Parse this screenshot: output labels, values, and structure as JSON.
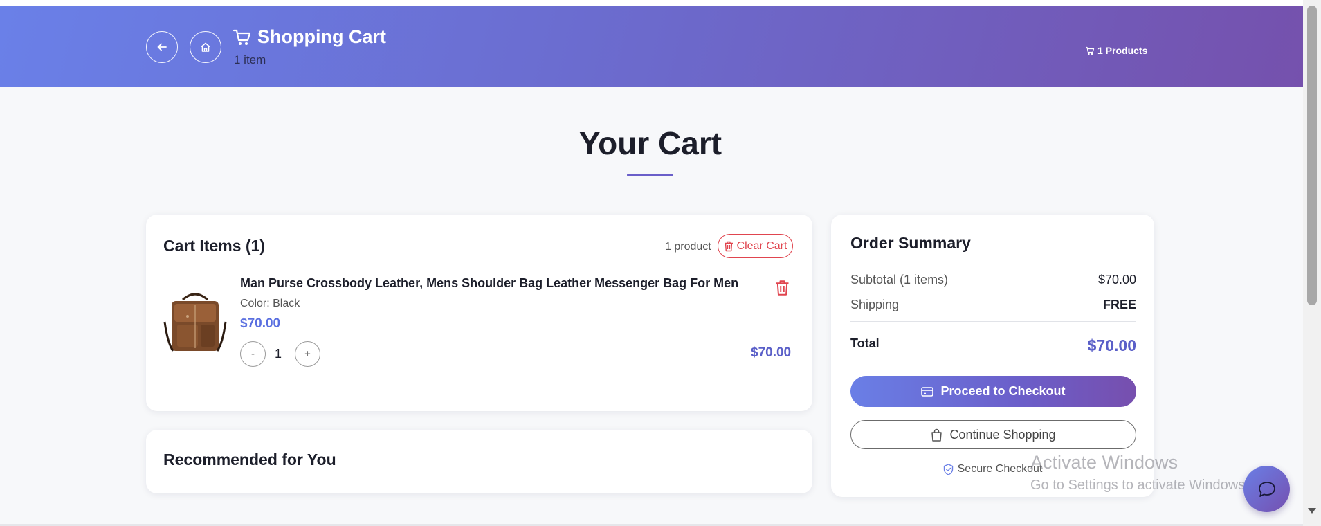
{
  "header": {
    "title": "Shopping Cart",
    "subtitle": "1 item",
    "products_badge": "1 Products",
    "icons": [
      "arrow-left-icon",
      "home-icon",
      "cart-icon"
    ]
  },
  "page_title": "Your Cart",
  "cart": {
    "title": "Cart Items (1)",
    "product_count": "1 product",
    "clear_label": "Clear Cart",
    "items": [
      {
        "name": "Man Purse Crossbody Leather, Mens Shoulder Bag Leather Messenger Bag For Men",
        "color": "Color: Black",
        "price": "$70.00",
        "quantity_minus": "-",
        "quantity": "1",
        "quantity_plus": "+",
        "line_total": "$70.00"
      }
    ]
  },
  "recommended": {
    "title": "Recommended for You"
  },
  "summary": {
    "title": "Order Summary",
    "subtotal_label": "Subtotal (1 items)",
    "subtotal_value": "$70.00",
    "shipping_label": "Shipping",
    "shipping_value": "FREE",
    "total_label": "Total",
    "total_value": "$70.00",
    "checkout_label": "Proceed to Checkout",
    "continue_label": "Continue Shopping",
    "secure_label": "Secure Checkout"
  },
  "watermark": {
    "line1": "Activate Windows",
    "line2": "Go to Settings to activate Windows."
  },
  "colors": {
    "header_start": "#6a80e8",
    "header_end": "#7551ad",
    "accent": "#5a5fc8",
    "danger": "#e0454f"
  }
}
